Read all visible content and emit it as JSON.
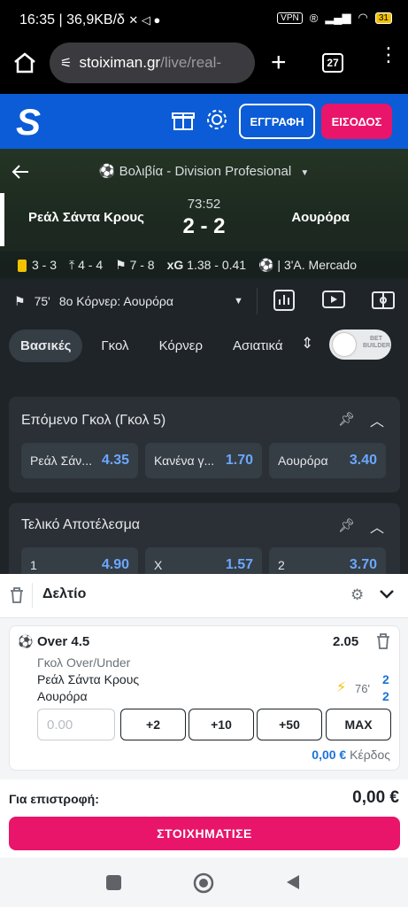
{
  "status_bar": {
    "time": "16:35",
    "net_speed": "36,9KB/δ",
    "vpn": "VPN",
    "battery": "31"
  },
  "browser": {
    "url_host": "stoiximan.gr",
    "url_path": "/live/real-",
    "tab_count": "27"
  },
  "header": {
    "logo": "S",
    "register_label": "ΕΓΓΡΑΦΗ",
    "login_label": "ΕΙΣΟΔΟΣ"
  },
  "match": {
    "league": "Βολιβία - Division Profesional",
    "home_team": "Ρεάλ Σάντα Κρους",
    "away_team": "Αουρόρα",
    "clock": "73:52",
    "score": "2 - 2",
    "stats": {
      "cards": "3 - 3",
      "shots": "4 - 4",
      "attacks": "7 - 8",
      "xg_label": "xG",
      "xg": "1.38 - 0.41",
      "last_event": "3'A. Mercado"
    }
  },
  "event_feed": {
    "minute": "75'",
    "text": "8ο Κόρνερ: Αουρόρα"
  },
  "market_tabs": [
    {
      "label": "Βασικές"
    },
    {
      "label": "Γκολ"
    },
    {
      "label": "Κόρνερ"
    },
    {
      "label": "Ασιατικά"
    }
  ],
  "bet_builder": {
    "label_line1": "BET",
    "label_line2": "BUILDER"
  },
  "markets": [
    {
      "title": "Επόμενο Γκολ (Γκολ 5)",
      "odds": [
        {
          "label": "Ρεάλ Σάν...",
          "value": "4.35"
        },
        {
          "label": "Κανένα γ...",
          "value": "1.70"
        },
        {
          "label": "Αουρόρα",
          "value": "3.40"
        }
      ]
    },
    {
      "title": "Τελικό Αποτέλεσμα",
      "odds": [
        {
          "label": "1",
          "value": "4.90"
        },
        {
          "label": "X",
          "value": "1.57"
        },
        {
          "label": "2",
          "value": "3.70"
        }
      ]
    }
  ],
  "betslip": {
    "title": "Δελτίο",
    "selection": "Over 4.5",
    "odds": "2.05",
    "market": "Γκολ Over/Under",
    "home": "Ρεάλ Σάντα Κρους",
    "away": "Αουρόρα",
    "minute": "76'",
    "home_score": "2",
    "away_score": "2",
    "stake_placeholder": "0.00",
    "quick_stakes": [
      "+2",
      "+10",
      "+50",
      "MAX"
    ],
    "profit_value": "0,00 €",
    "profit_label": "Κέρδος",
    "return_label": "Για επιστροφή:",
    "return_value": "0,00 €",
    "place_bet_label": "ΣΤΟΙΧΗΜΑΤΙΣΕ"
  },
  "colors": {
    "brand_blue": "#0b5cd6",
    "brand_pink": "#e8156a",
    "odds_blue": "#6aa8ff"
  }
}
